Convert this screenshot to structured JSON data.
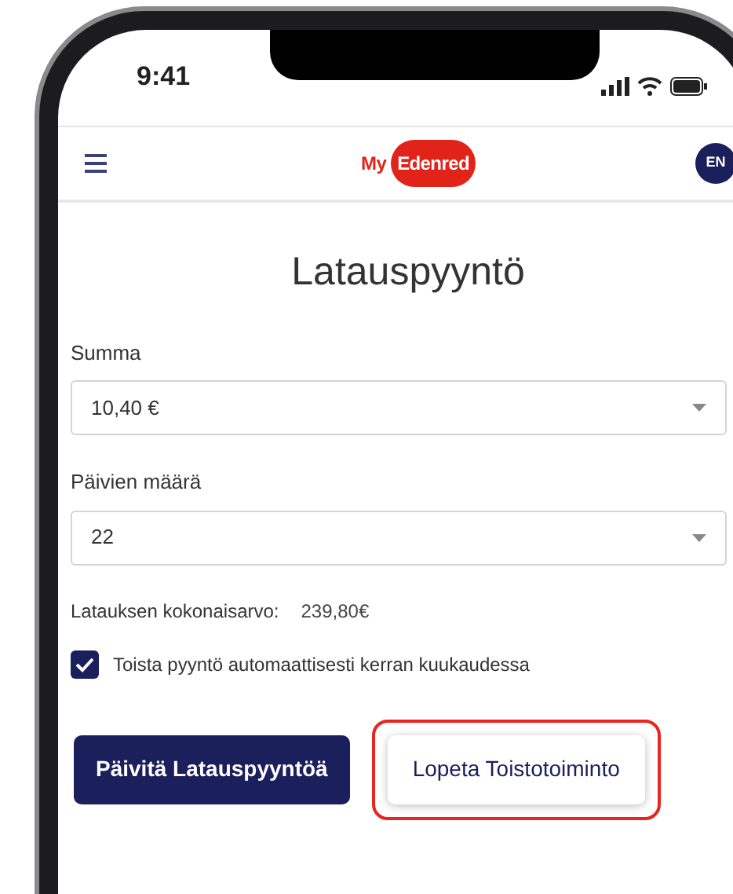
{
  "status_bar": {
    "time": "9:41"
  },
  "header": {
    "logo": {
      "prefix": "My",
      "name": "Edenred"
    },
    "language": "EN"
  },
  "title": "Latauspyyntö",
  "fields": [
    {
      "label": "Summa",
      "value": "10,40 €"
    },
    {
      "label": "Päivien määrä",
      "value": "22"
    }
  ],
  "total": {
    "label": "Latauksen kokonaisarvo:",
    "value": "239,80€"
  },
  "repeat": {
    "label": "Toista pyyntö automaattisesti kerran kuukaudessa",
    "checked": true
  },
  "buttons": [
    {
      "label": "Päivitä Latauspyyntöä",
      "kind": "primary",
      "highlighted": false
    },
    {
      "label": "Lopeta Toistotoiminto",
      "kind": "secondary",
      "highlighted": true
    }
  ]
}
